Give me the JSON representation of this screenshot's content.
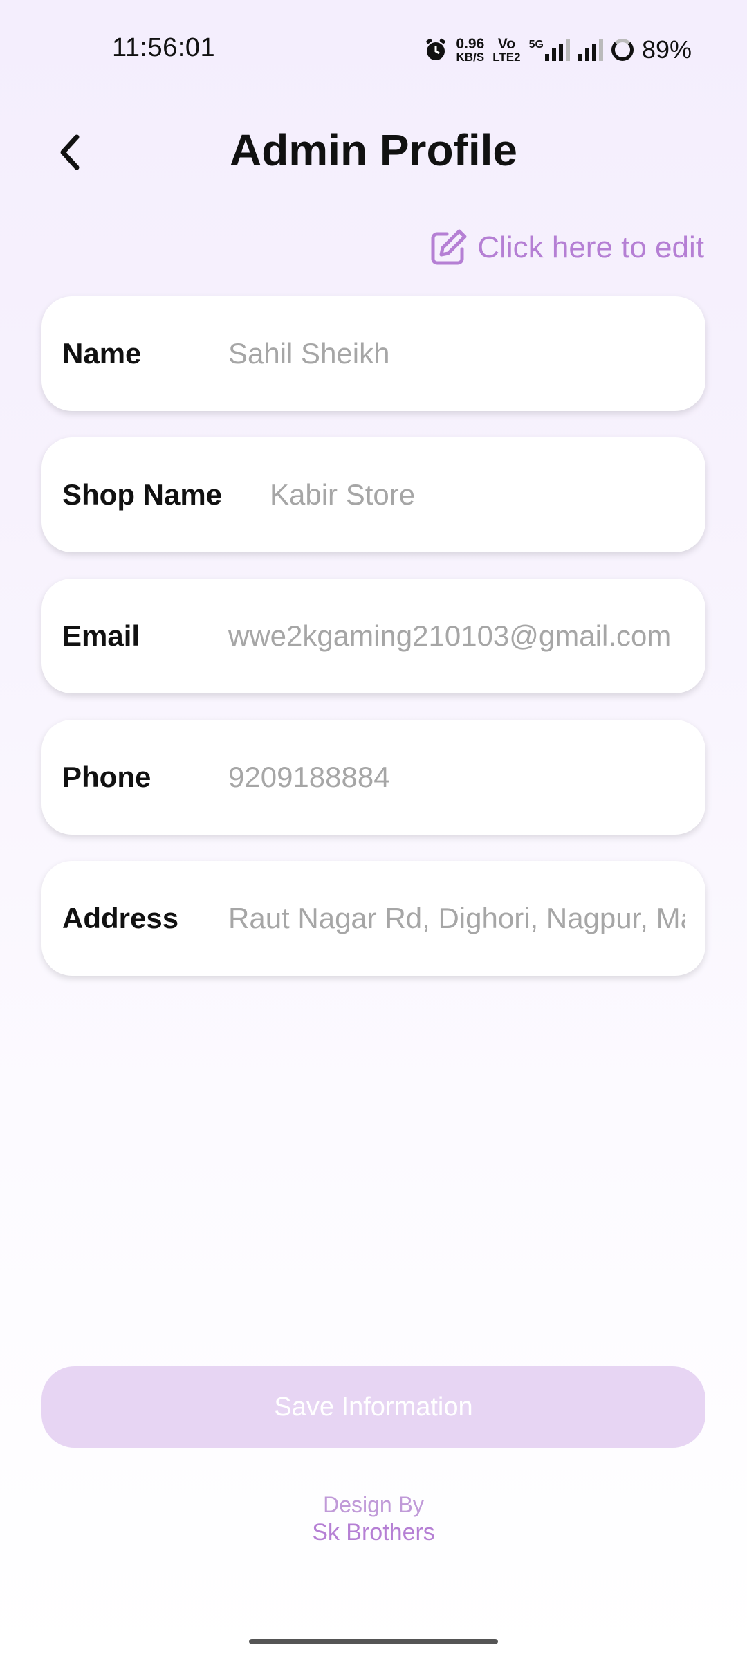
{
  "status_bar": {
    "time": "11:56:01",
    "net_speed": "0.96",
    "net_unit": "KB/S",
    "volte_top": "Vo",
    "volte_bottom": "LTE2",
    "network": "5G",
    "battery": "89%"
  },
  "header": {
    "title": "Admin Profile",
    "back_icon": "chevron-left-icon"
  },
  "edit": {
    "label": "Click here to edit",
    "icon": "edit-icon"
  },
  "fields": [
    {
      "label": "Name",
      "value": "Sahil Sheikh"
    },
    {
      "label": "Shop Name",
      "value": "Kabir Store"
    },
    {
      "label": "Email",
      "value": "wwe2kgaming210103@gmail.com"
    },
    {
      "label": "Phone",
      "value": "9209188884"
    },
    {
      "label": "Address",
      "value": "Raut Nagar Rd, Dighori, Nagpur, Ma"
    }
  ],
  "save_button": "Save Information",
  "credits": {
    "line1": "Design By",
    "line2": "Sk Brothers"
  },
  "colors": {
    "accent": "#b57fd4",
    "button_disabled": "#e7d5f3",
    "background": "#f4eefd"
  }
}
